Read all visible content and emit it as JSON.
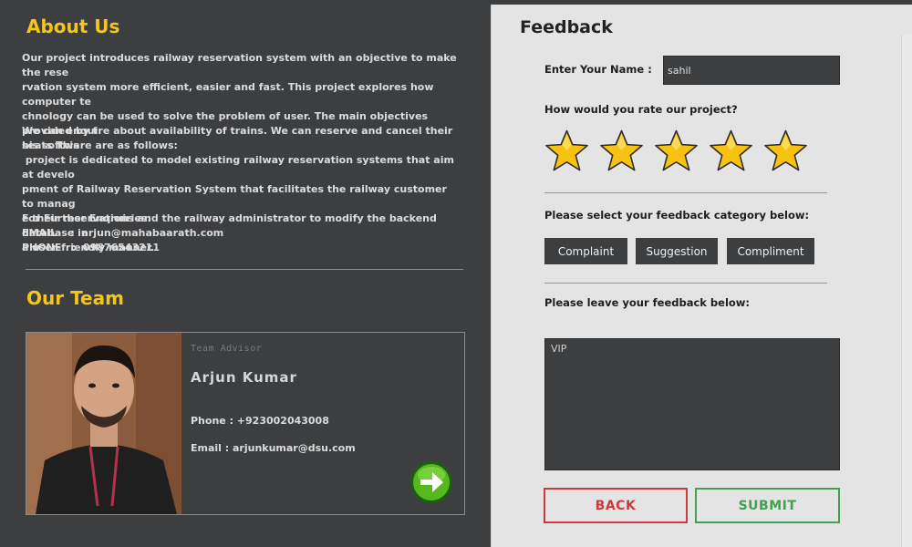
{
  "about": {
    "title": "About Us",
    "paragraph1": "Our project introduces railway reservation system with an objective to make the rese\nrvation system more efficient, easier and fast. This project explores how computer te\nchnology can be used to solve the problem of user. The main objectives provided by t\nhis software are as follows:",
    "paragraph2": "We can enquire about availability of trains. We can reserve and cancel their seats This\n project is dedicated to model existing railway reservation systems that aim at develo\npment of Railway Reservation System that facilitates the railway customer to manag\ne their reservations and the railway administrator to modify the backend database in\na user-friendly manner.",
    "enquiries_label": "For Further Enqruiries:",
    "email_line": "EMAIL    :  arjun@mahabaarath.com",
    "phone_line": "PHONE   :  09876543211"
  },
  "team": {
    "title": "Our Team",
    "member": {
      "role": "Team Advisor",
      "name": "Arjun Kumar",
      "phone_line": "Phone : +923002043008",
      "email_line": "Email  : arjunkumar@dsu.com"
    }
  },
  "feedback": {
    "title": "Feedback",
    "name_label": "Enter Your Name :",
    "name_value": "sahil",
    "rating_question": "How would you rate our project?",
    "rating": 5,
    "rating_max": 5,
    "category_prompt": "Please select your feedback category below:",
    "categories": [
      "Complaint",
      "Suggestion",
      "Compliment"
    ],
    "comment_prompt": "Please leave your feedback below:",
    "comment_value": "VIP",
    "back_label": "BACK",
    "submit_label": "SUBMIT"
  },
  "colors": {
    "accent_yellow": "#f5c518",
    "back_red": "#cc3b3b",
    "submit_green": "#3ea24e",
    "panel_dark": "#3d3e40",
    "panel_light": "#e4e4e4"
  },
  "icons": {
    "rating": "star-icon",
    "next": "arrow-right-icon"
  }
}
